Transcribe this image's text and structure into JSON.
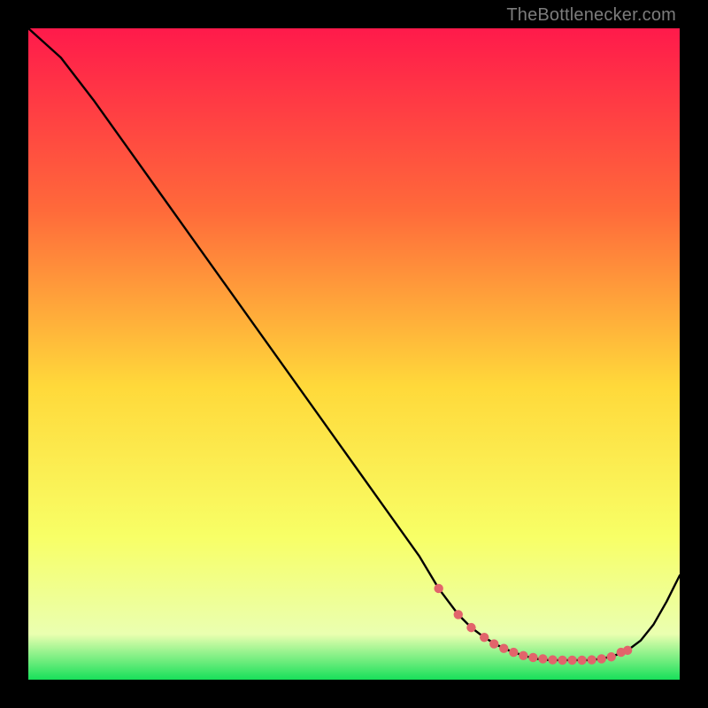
{
  "attribution": "TheBottlenecker.com",
  "colors": {
    "gradient_top": "#ff1a4b",
    "gradient_mid1": "#ff6a3a",
    "gradient_mid2": "#ffd93a",
    "gradient_mid3": "#f8ff66",
    "gradient_low": "#eaffb0",
    "gradient_bottom": "#18e05a",
    "curve": "#000000",
    "marker": "#e2646b"
  },
  "chart_data": {
    "type": "line",
    "title": "",
    "xlabel": "",
    "ylabel": "",
    "xlim": [
      0,
      100
    ],
    "ylim": [
      0,
      100
    ],
    "grid": false,
    "series": [
      {
        "name": "bottleneck-curve",
        "x": [
          0,
          5,
          10,
          15,
          20,
          25,
          30,
          35,
          40,
          45,
          50,
          55,
          60,
          63,
          66,
          68,
          70,
          72,
          74,
          76,
          78,
          80,
          82,
          84,
          86,
          88,
          90,
          92,
          94,
          96,
          98,
          100
        ],
        "y": [
          100,
          95.5,
          89,
          82,
          75,
          68,
          61,
          54,
          47,
          40,
          33,
          26,
          19,
          14,
          10,
          8,
          6.5,
          5.3,
          4.4,
          3.7,
          3.2,
          3.0,
          3.0,
          3.0,
          3.0,
          3.2,
          3.7,
          4.5,
          6.0,
          8.5,
          12,
          16
        ]
      }
    ],
    "markers": {
      "name": "highlight-points",
      "x": [
        63,
        66,
        68,
        70,
        71.5,
        73,
        74.5,
        76,
        77.5,
        79,
        80.5,
        82,
        83.5,
        85,
        86.5,
        88,
        89.5,
        91,
        92
      ],
      "y": [
        14,
        10,
        8,
        6.5,
        5.5,
        4.8,
        4.2,
        3.7,
        3.4,
        3.2,
        3.05,
        3.0,
        3.0,
        3.0,
        3.05,
        3.2,
        3.5,
        4.2,
        4.5
      ]
    }
  }
}
